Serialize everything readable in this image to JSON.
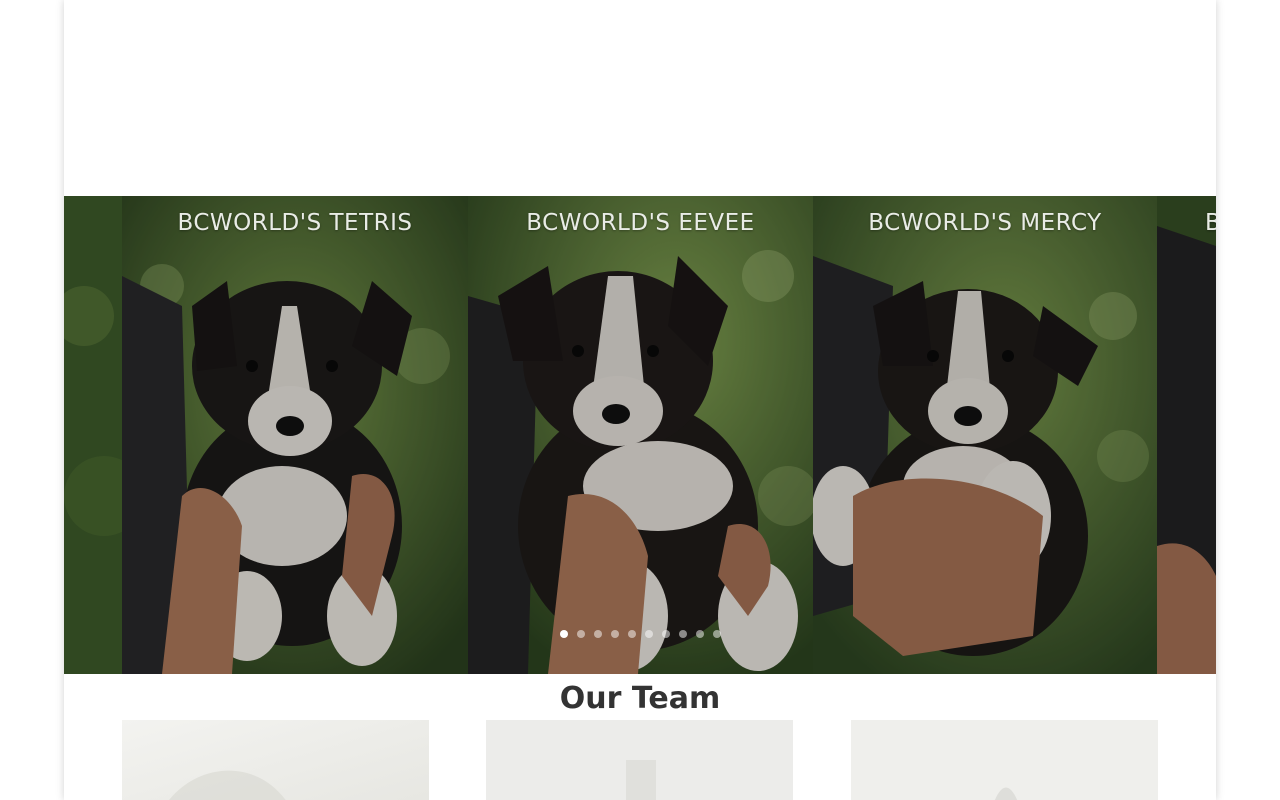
{
  "slider": {
    "slides": [
      {
        "title": "BCWORLD'S TETRIS",
        "alt": "Tetris puppy"
      },
      {
        "title": "BCWORLD'S EEVEE",
        "alt": "Eevee puppy"
      },
      {
        "title": "BCWORLD'S MERCY",
        "alt": "Mercy puppy"
      },
      {
        "title": "B",
        "alt": "Next puppy (partial)"
      }
    ],
    "dots_total": 10,
    "active_dot": 1
  },
  "team": {
    "heading": "Our Team"
  },
  "colors": {
    "foliage_dark": "#2e4520",
    "foliage_light": "#6f8f45",
    "heading_text": "#333333"
  }
}
